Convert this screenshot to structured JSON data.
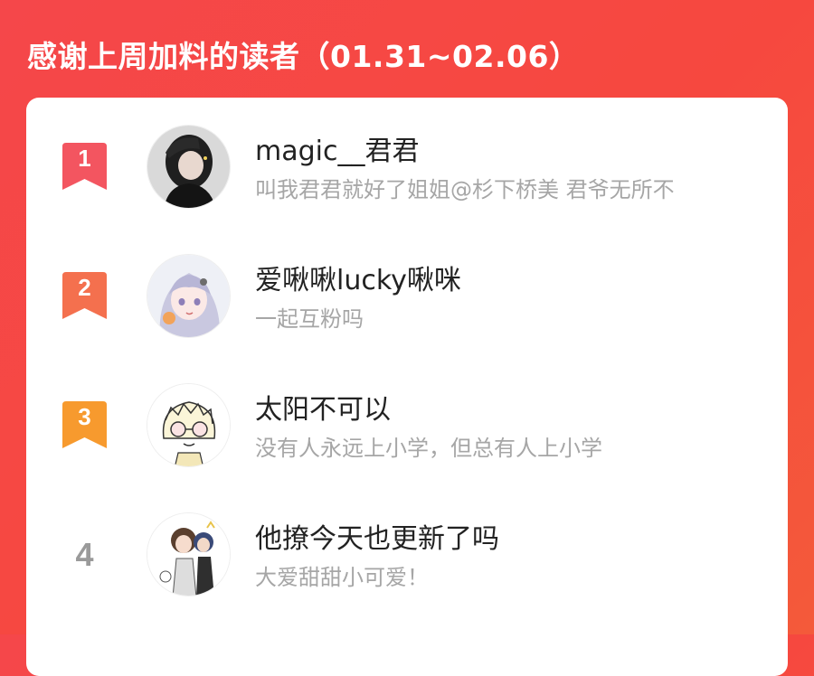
{
  "title": "感谢上周加料的读者（01.31~02.06）",
  "colors": {
    "background": "#f5474a",
    "rank1": "#f35560",
    "rank2": "#f4704e",
    "rank3": "#f79a2e",
    "rank_plain": "#9a9a9a"
  },
  "readers": [
    {
      "rank": "1",
      "name": "magic__君君",
      "bio": "叫我君君就好了姐姐@杉下桥美 君爷无所不",
      "avatar": "avatar-dark-hair-icon"
    },
    {
      "rank": "2",
      "name": "爱啾啾lucky啾咪",
      "bio": "一起互粉吗",
      "avatar": "avatar-anime-girl-icon"
    },
    {
      "rank": "3",
      "name": "太阳不可以",
      "bio": "没有人永远上小学，但总有人上小学",
      "avatar": "avatar-cartoon-glasses-icon"
    },
    {
      "rank": "4",
      "name": "他撩今天也更新了吗",
      "bio": "大爱甜甜小可爱！",
      "avatar": "avatar-cartoon-group-icon"
    }
  ]
}
